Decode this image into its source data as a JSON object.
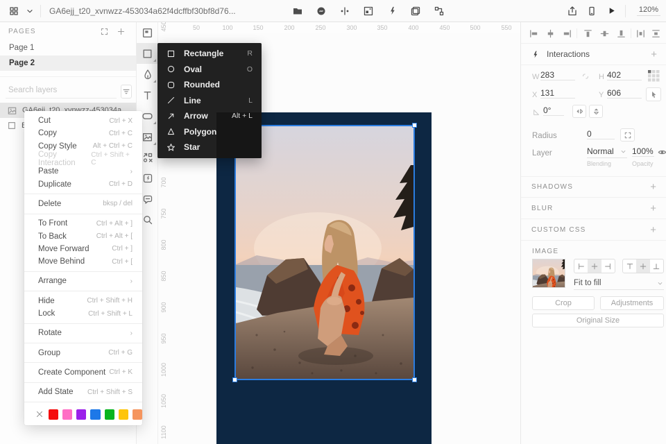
{
  "topbar": {
    "title": "GA6ejj_t20_xvnwzz-453034a62f4dcffbf30bf8d76...",
    "zoom": "120%"
  },
  "pages": {
    "header": "PAGES",
    "items": [
      {
        "name": "Page 1"
      },
      {
        "name": "Page 2"
      }
    ]
  },
  "layers": {
    "search_placeholder": "Search layers",
    "items": [
      {
        "name": "GA6ejj_t20_xvnwzz-453034a..."
      },
      {
        "name": "B"
      }
    ]
  },
  "shape_menu": {
    "items": [
      {
        "label": "Rectangle",
        "shortcut": "R"
      },
      {
        "label": "Oval",
        "shortcut": "O"
      },
      {
        "label": "Rounded",
        "shortcut": ""
      },
      {
        "label": "Line",
        "shortcut": "L"
      },
      {
        "label": "Arrow",
        "shortcut": "Alt + L"
      },
      {
        "label": "Polygon",
        "shortcut": ""
      },
      {
        "label": "Star",
        "shortcut": ""
      }
    ]
  },
  "context_menu": {
    "items": [
      {
        "label": "Cut",
        "shortcut": "Ctrl + X"
      },
      {
        "label": "Copy",
        "shortcut": "Ctrl + C"
      },
      {
        "label": "Copy Style",
        "shortcut": "Alt + Ctrl + C"
      },
      {
        "label": "Copy Interaction",
        "shortcut": "Ctrl + Shift + C"
      },
      {
        "label": "Paste",
        "shortcut": "›"
      },
      {
        "label": "Duplicate",
        "shortcut": "Ctrl + D"
      },
      {
        "label": "Delete",
        "shortcut": "bksp / del"
      },
      {
        "label": "To Front",
        "shortcut": "Ctrl + Alt + ]"
      },
      {
        "label": "To Back",
        "shortcut": "Ctrl + Alt + ["
      },
      {
        "label": "Move Forward",
        "shortcut": "Ctrl + ]"
      },
      {
        "label": "Move Behind",
        "shortcut": "Ctrl + ["
      },
      {
        "label": "Arrange",
        "shortcut": "›"
      },
      {
        "label": "Hide",
        "shortcut": "Ctrl + Shift + H"
      },
      {
        "label": "Lock",
        "shortcut": "Ctrl + Shift + L"
      },
      {
        "label": "Rotate",
        "shortcut": "›"
      },
      {
        "label": "Group",
        "shortcut": "Ctrl + G"
      },
      {
        "label": "Create Component",
        "shortcut": "Ctrl + K"
      },
      {
        "label": "Add State",
        "shortcut": "Ctrl + Shift + S"
      }
    ],
    "swatches": [
      "#f50d0d",
      "#ff6fc5",
      "#9b20ea",
      "#1d78e8",
      "#07b41f",
      "#fec50a",
      "#f5955e"
    ]
  },
  "rulers": {
    "h": [
      "50",
      "100",
      "150",
      "200",
      "250",
      "300",
      "350",
      "400",
      "450",
      "500",
      "550"
    ],
    "v": [
      "450",
      "700",
      "750",
      "800",
      "850",
      "900",
      "950",
      "1000",
      "1050",
      "1100"
    ]
  },
  "inspector": {
    "interactions": "Interactions",
    "w_label": "W",
    "w": "283",
    "h_label": "H",
    "h": "402",
    "x_label": "X",
    "x": "131",
    "y_label": "Y",
    "y": "606",
    "angle": "0°",
    "radius_label": "Radius",
    "radius": "0",
    "layer_label": "Layer",
    "blend": "Normal",
    "blend_sub": "Blending",
    "opacity": "100%",
    "opacity_sub": "Opacity",
    "shadows": "SHADOWS",
    "blur": "BLUR",
    "custom_css": "CUSTOM CSS",
    "image_header": "IMAGE",
    "fit": "Fit to fill",
    "crop": "Crop",
    "adjustments": "Adjustments",
    "original_size": "Original Size"
  }
}
